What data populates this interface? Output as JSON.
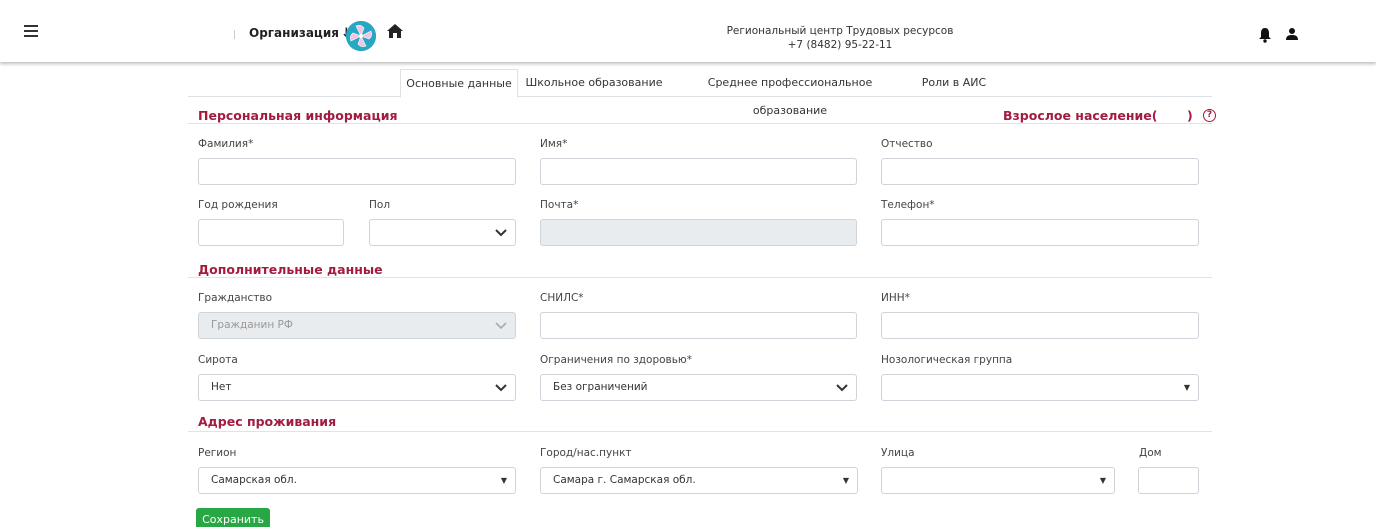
{
  "header": {
    "organization_label": "Организация",
    "org_name": "Региональный центр Трудовых ресурсов",
    "org_phone": "+7 (8482) 95-22-11",
    "accent_color": "#28a7c4"
  },
  "tabs": [
    {
      "label": "Основные данные",
      "active": true
    },
    {
      "label": "Школьное образование",
      "active": false
    },
    {
      "label": "Среднее профессиональное образование",
      "active": false
    },
    {
      "label": "Роли в АИС",
      "active": false
    }
  ],
  "personal": {
    "title": "Персональная информация",
    "category_open": "Взрослое население(",
    "category_close": ")",
    "help_glyph": "?",
    "last_name_label": "Фамилия*",
    "first_name_label": "Имя*",
    "middle_name_label": "Отчество",
    "birth_year_label": "Год рождения",
    "gender_label": "Пол",
    "email_label": "Почта*",
    "phone_label": "Телефон*"
  },
  "additional": {
    "title": "Дополнительные данные",
    "citizenship_label": "Гражданство",
    "citizenship_value": "Гражданин РФ",
    "snils_label": "СНИЛС*",
    "inn_label": "ИНН*",
    "orphan_label": "Сирота",
    "orphan_value": "Нет",
    "health_label": "Ограничения по здоровью*",
    "health_value": "Без ограничений",
    "nosology_label": "Нозологическая группа",
    "nosology_value": ""
  },
  "address": {
    "title": "Адрес проживания",
    "region_label": "Регион",
    "region_value": "Самарская обл.",
    "city_label": "Город/нас.пункт",
    "city_value": "Самара г. Самарская обл.",
    "street_label": "Улица",
    "street_value": "",
    "house_label": "Дом"
  },
  "actions": {
    "save_label": "Сохранить",
    "save_color": "#28a745"
  },
  "colors": {
    "section_title": "#a31c3f"
  }
}
